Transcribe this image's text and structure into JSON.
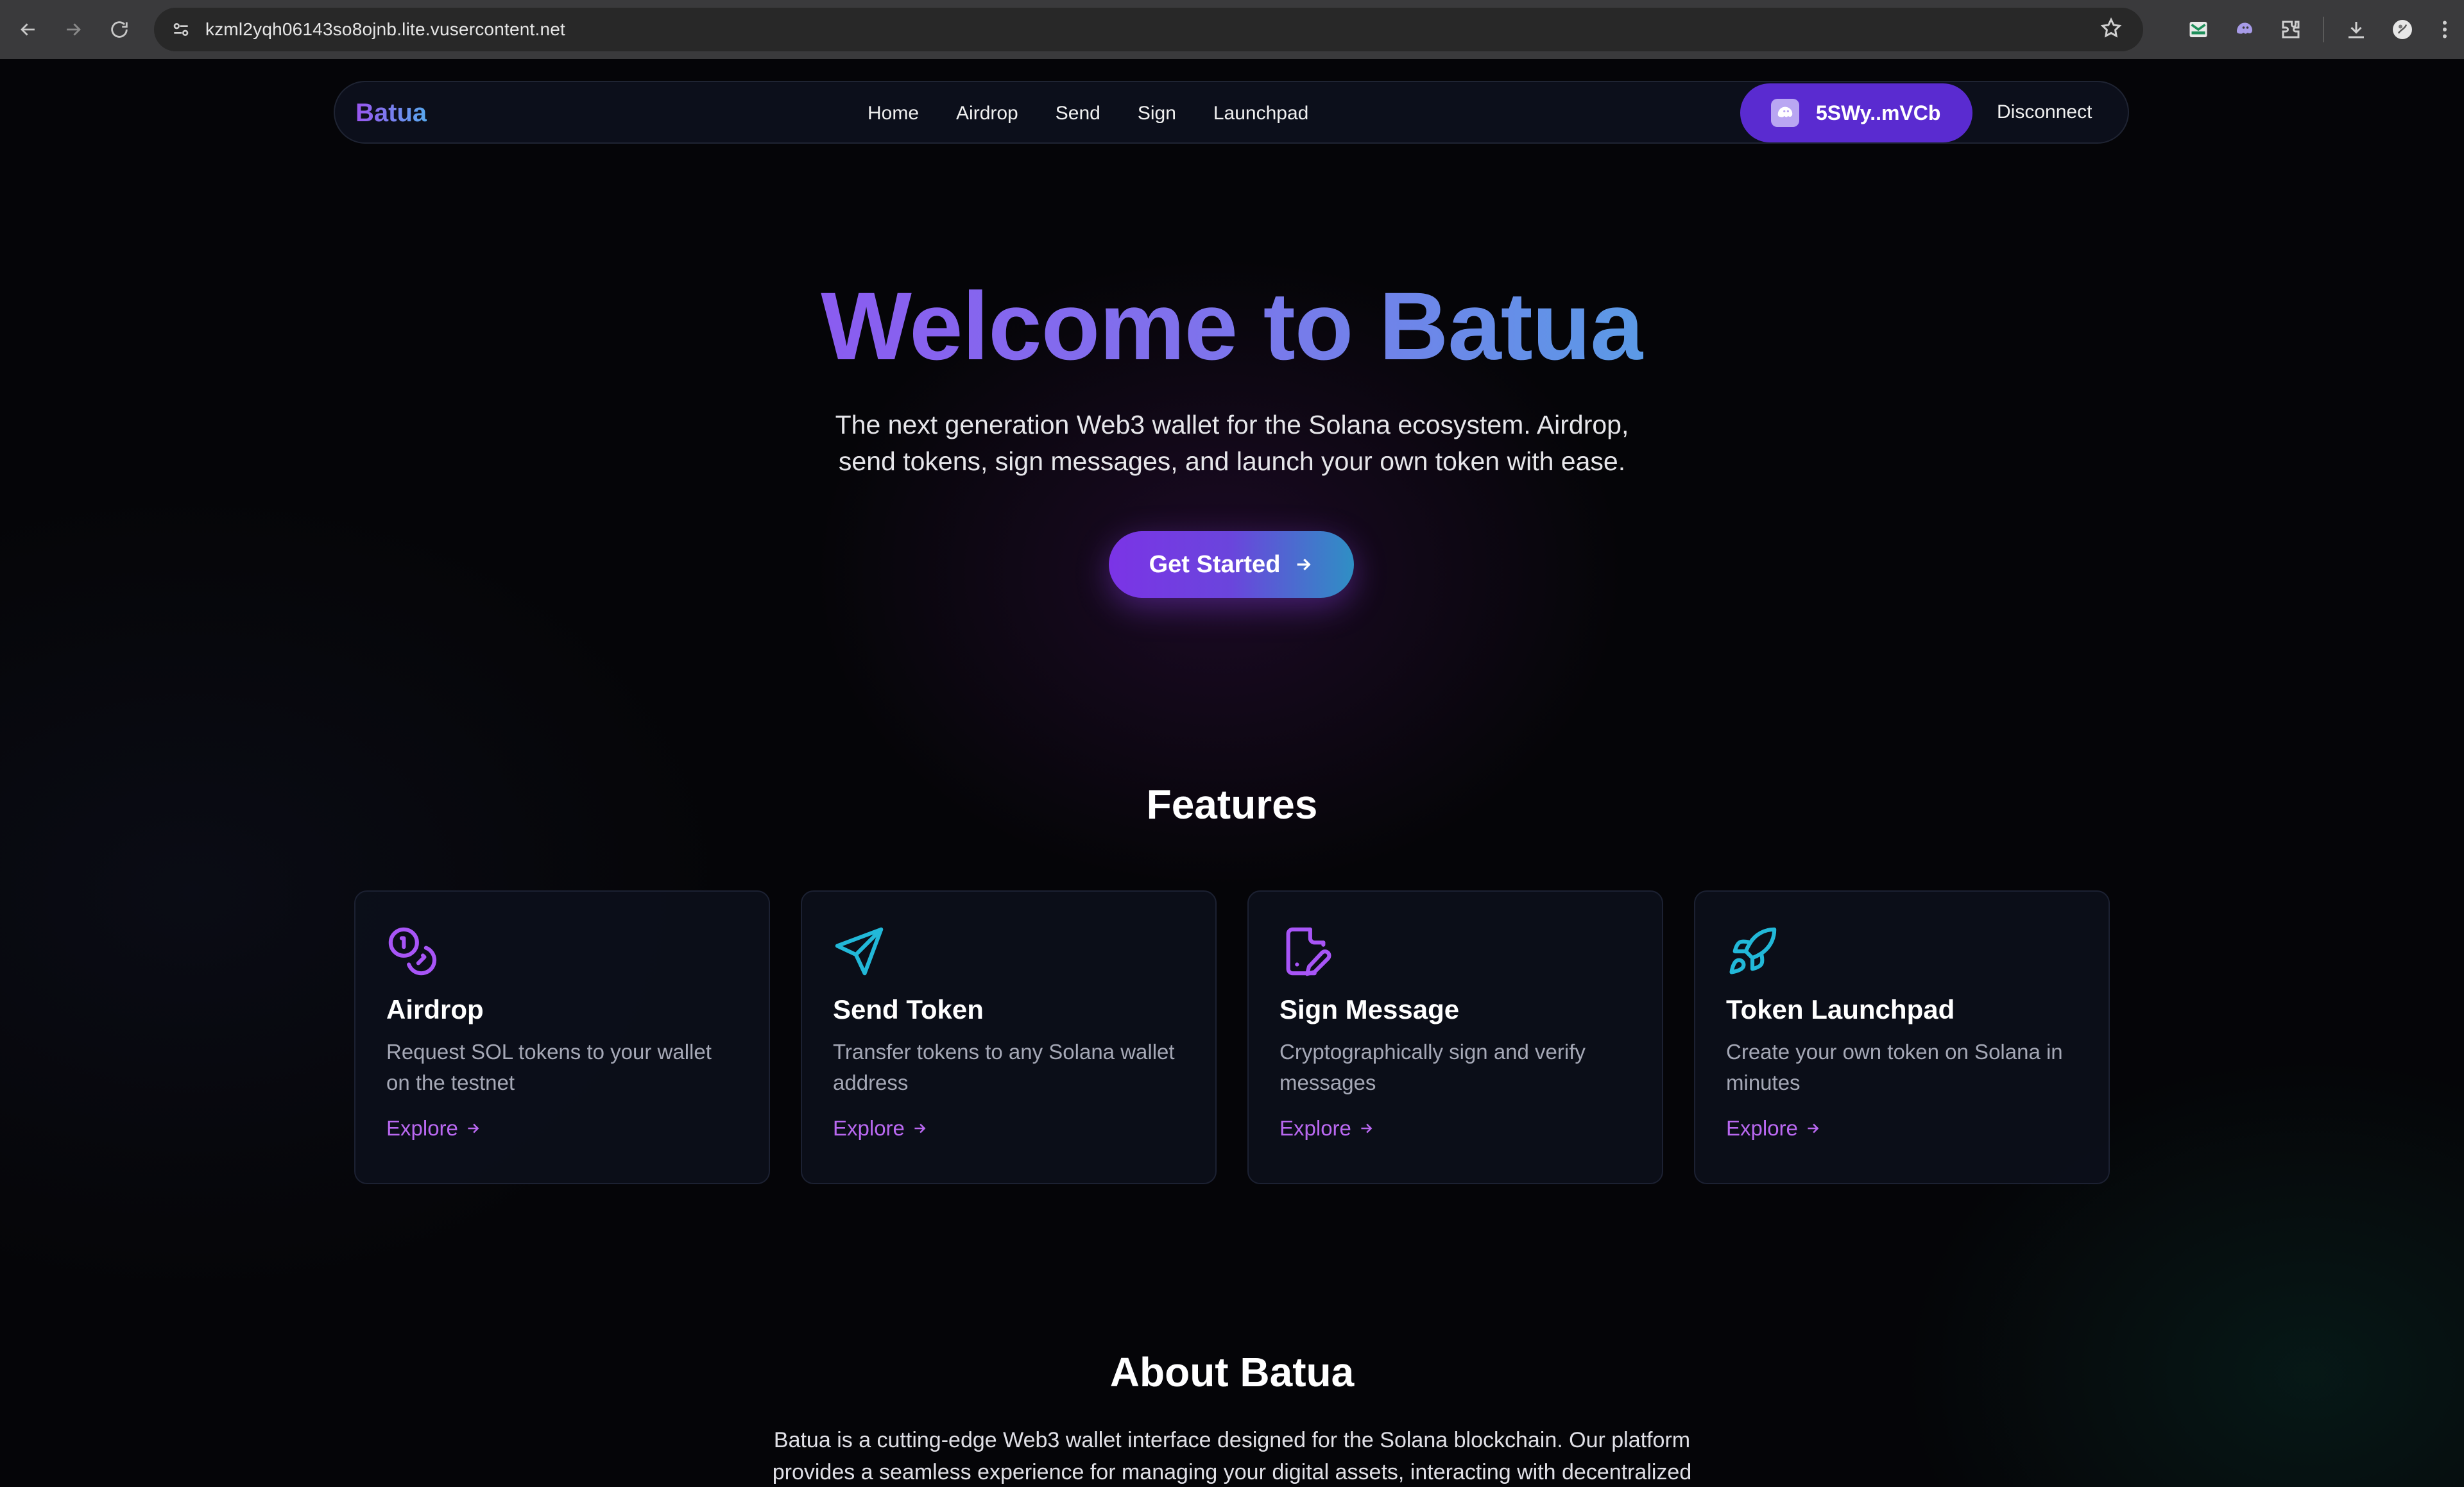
{
  "browser": {
    "url": "kzml2yqh06143so8ojnb.lite.vusercontent.net"
  },
  "nav": {
    "brand": "Batua",
    "links": [
      "Home",
      "Airdrop",
      "Send",
      "Sign",
      "Launchpad"
    ],
    "wallet_address": "5SWy..mVCb",
    "disconnect_label": "Disconnect"
  },
  "hero": {
    "title": "Welcome to Batua",
    "subtitle_line1": "The next generation Web3 wallet for the Solana ecosystem. Airdrop,",
    "subtitle_line2": "send tokens, sign messages, and launch your own token with ease.",
    "cta_label": "Get Started"
  },
  "features": {
    "title": "Features",
    "cards": [
      {
        "icon": "coins-icon",
        "title": "Airdrop",
        "desc_line1": "Request SOL tokens to your wallet",
        "desc_line2": "on the testnet",
        "link": "Explore"
      },
      {
        "icon": "send-icon",
        "title": "Send Token",
        "desc_line1": "Transfer tokens to any Solana wallet",
        "desc_line2": "address",
        "link": "Explore"
      },
      {
        "icon": "file-signature-icon",
        "title": "Sign Message",
        "desc_line1": "Cryptographically sign and verify",
        "desc_line2": "messages",
        "link": "Explore"
      },
      {
        "icon": "rocket-icon",
        "title": "Token Launchpad",
        "desc_line1": "Create your own token on Solana in",
        "desc_line2": "minutes",
        "link": "Explore"
      }
    ]
  },
  "about": {
    "title": "About Batua",
    "text_line1": "Batua is a cutting-edge Web3 wallet interface designed for the Solana blockchain. Our platform",
    "text_line2": "provides a seamless experience for managing your digital assets, interacting with decentralized"
  },
  "colors": {
    "accent_purple": "#7b34e6",
    "accent_blue": "#2f8fc4",
    "icon_purple": "#a855f7",
    "icon_cyan": "#22b8d8",
    "background": "#050508"
  }
}
